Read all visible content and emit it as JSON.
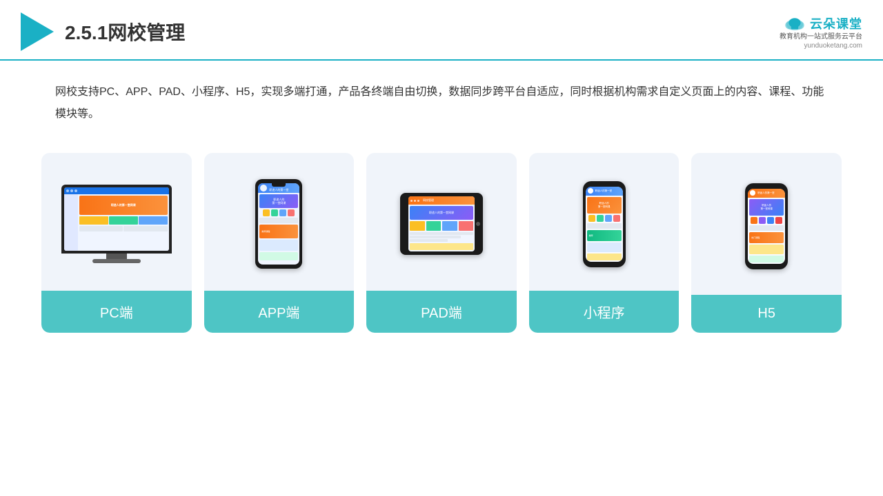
{
  "header": {
    "title": "2.5.1网校管理",
    "brand_name": "云朵课堂",
    "brand_url": "yunduoketang.com",
    "brand_tagline": "教育机构一站\n式服务云平台"
  },
  "description": {
    "text": "网校支持PC、APP、PAD、小程序、H5，实现多端打通，产品各终端自由切换，数据同步跨平台自适应，同时根据机构需求自定义页面上的内容、课程、功能模块等。"
  },
  "cards": [
    {
      "id": "pc",
      "label": "PC端"
    },
    {
      "id": "app",
      "label": "APP端"
    },
    {
      "id": "pad",
      "label": "PAD端"
    },
    {
      "id": "miniapp",
      "label": "小程序"
    },
    {
      "id": "h5",
      "label": "H5"
    }
  ],
  "colors": {
    "accent": "#1ab0c5",
    "card_bg": "#f0f4fa",
    "card_label_bg": "#4ec5c5",
    "header_border": "#1ab0c5"
  }
}
